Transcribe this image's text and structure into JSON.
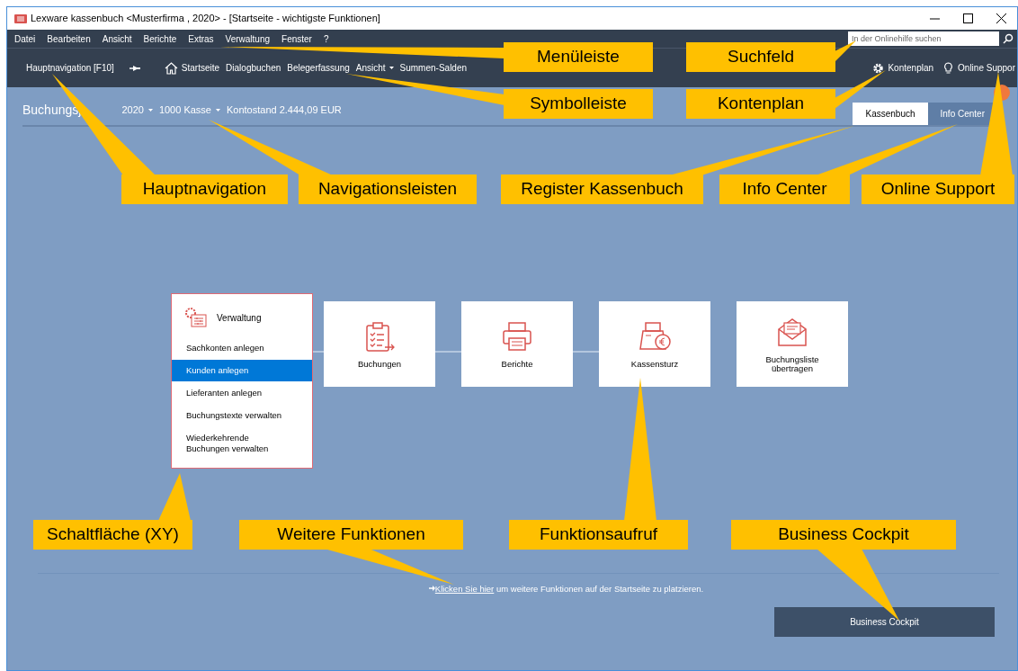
{
  "window": {
    "title": "Lexware kassenbuch <Musterfirma ,  2020> - [Startseite - wichtigste Funktionen]"
  },
  "menu": [
    "Datei",
    "Bearbeiten",
    "Ansicht",
    "Berichte",
    "Extras",
    "Verwaltung",
    "Fenster",
    "?"
  ],
  "search": {
    "placeholder": "In der Onlinehilfe suchen"
  },
  "toolbar": {
    "main_nav": "Hauptnavigation [F10]",
    "items": [
      {
        "label": "Startseite",
        "kind": "home"
      },
      {
        "label": "Dialogbuchen",
        "kind": "plain"
      },
      {
        "label": "Belegerfassung",
        "kind": "plain"
      },
      {
        "label": "Ansicht",
        "kind": "dropdown"
      },
      {
        "label": "Summen-Salden",
        "kind": "plain"
      }
    ],
    "right": [
      {
        "label": "Kontenplan",
        "kind": "gear"
      },
      {
        "label": "Online Suppor",
        "kind": "bulb"
      }
    ]
  },
  "navbar": {
    "label": "Buchungsj",
    "year": "2020",
    "account": "1000 Kasse",
    "balance": "Kontostand 2.444,09 EUR"
  },
  "tabs": [
    {
      "label": "Kassenbuch",
      "selected": true
    },
    {
      "label": "Info Center",
      "selected": false
    }
  ],
  "admin_panel": {
    "title": "Verwaltung",
    "items": [
      {
        "label": "Sachkonten anlegen",
        "selected": false
      },
      {
        "label": "Kunden anlegen",
        "selected": true
      },
      {
        "label": "Lieferanten anlegen",
        "selected": false
      },
      {
        "label": "Buchungstexte verwalten",
        "selected": false
      },
      {
        "label": "Wiederkehrende Buchungen verwalten",
        "selected": false
      }
    ]
  },
  "functions": [
    {
      "label": "Buchungen",
      "kind": "clipboard"
    },
    {
      "label": "Berichte",
      "kind": "printer"
    },
    {
      "label": "Kassensturz",
      "kind": "register"
    },
    {
      "label": "Buchungsliste übertragen",
      "kind": "envelope"
    }
  ],
  "more_link": {
    "link": "Klicken Sie hier",
    "text": "um weitere Funktionen auf der Startseite zu platzieren."
  },
  "cockpit_button": "Business Cockpit",
  "callouts": [
    "Menüleiste",
    "Suchfeld",
    "Symbolleiste",
    "Kontenplan",
    "Hauptnavigation",
    "Navigationsleisten",
    "Register Kassenbuch",
    "Info Center",
    "Online Support",
    "Schaltfläche (XY)",
    "Weitere Funktionen",
    "Funktionsaufruf",
    "Business Cockpit"
  ]
}
